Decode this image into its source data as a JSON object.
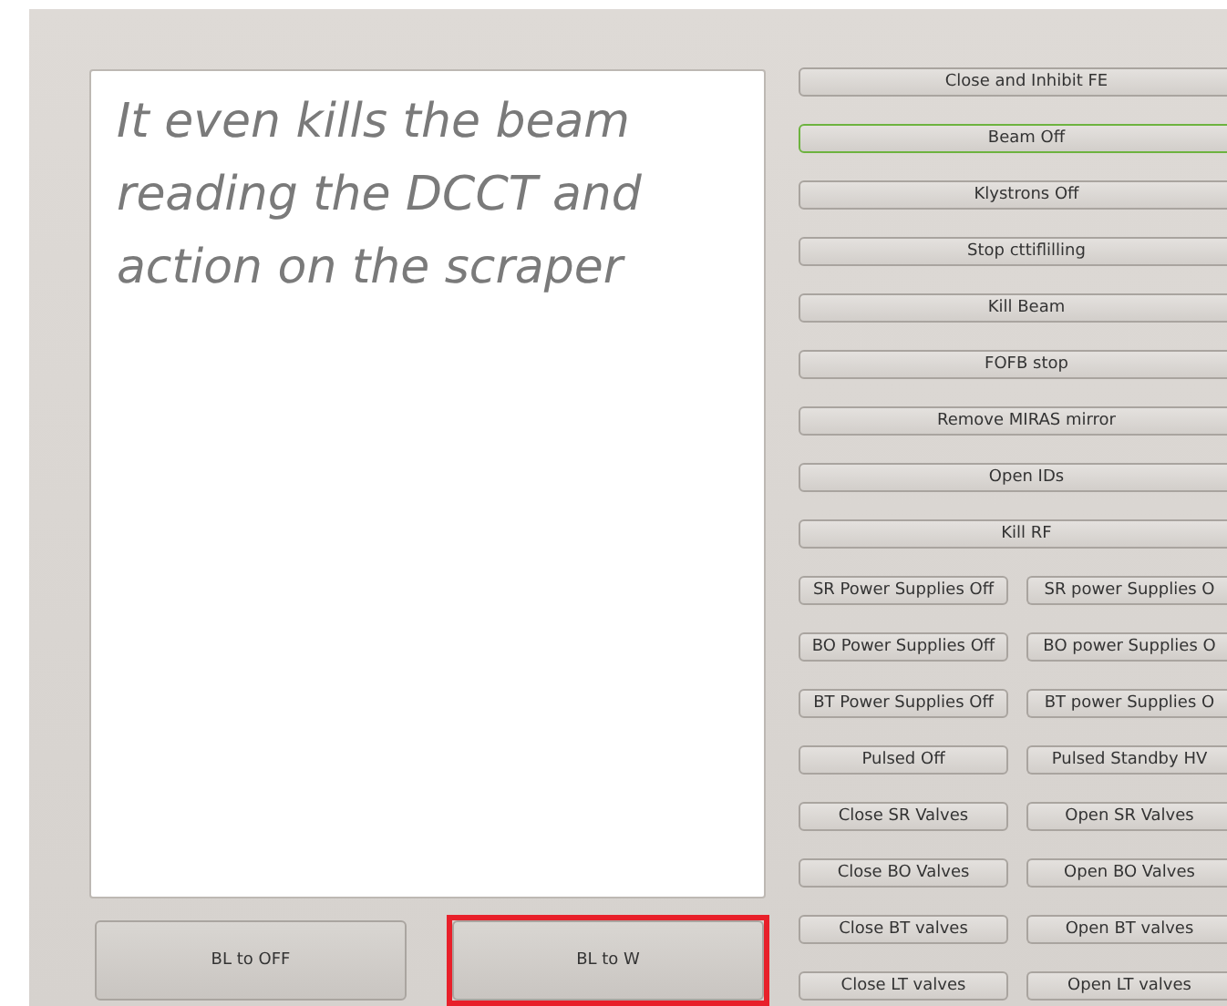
{
  "message": "It even kills the beam reading the DCCT and action on the scraper",
  "actions": [
    {
      "kind": "single",
      "buttons": [
        {
          "label": "Close and Inhibit FE",
          "focused": false
        }
      ]
    },
    {
      "kind": "single",
      "buttons": [
        {
          "label": "Beam Off",
          "focused": true
        }
      ]
    },
    {
      "kind": "single",
      "buttons": [
        {
          "label": "Klystrons Off",
          "focused": false
        }
      ]
    },
    {
      "kind": "single",
      "buttons": [
        {
          "label": "Stop cttiflilling",
          "focused": false
        }
      ]
    },
    {
      "kind": "single",
      "buttons": [
        {
          "label": "Kill Beam",
          "focused": false
        }
      ]
    },
    {
      "kind": "single",
      "buttons": [
        {
          "label": "FOFB stop",
          "focused": false
        }
      ]
    },
    {
      "kind": "single",
      "buttons": [
        {
          "label": "Remove MIRAS mirror",
          "focused": false
        }
      ]
    },
    {
      "kind": "single",
      "buttons": [
        {
          "label": "Open IDs",
          "focused": false
        }
      ]
    },
    {
      "kind": "single",
      "buttons": [
        {
          "label": "Kill RF",
          "focused": false
        }
      ]
    },
    {
      "kind": "pair",
      "buttons": [
        {
          "label": "SR Power Supplies Off",
          "focused": false
        },
        {
          "label": "SR power Supplies O",
          "focused": false
        }
      ]
    },
    {
      "kind": "pair",
      "buttons": [
        {
          "label": "BO Power Supplies Off",
          "focused": false
        },
        {
          "label": "BO power Supplies O",
          "focused": false
        }
      ]
    },
    {
      "kind": "pair",
      "buttons": [
        {
          "label": "BT Power Supplies Off",
          "focused": false
        },
        {
          "label": "BT power Supplies O",
          "focused": false
        }
      ]
    },
    {
      "kind": "pair",
      "buttons": [
        {
          "label": "Pulsed Off",
          "focused": false
        },
        {
          "label": "Pulsed Standby HV",
          "focused": false
        }
      ]
    },
    {
      "kind": "pair",
      "buttons": [
        {
          "label": "Close SR Valves",
          "focused": false
        },
        {
          "label": "Open SR Valves",
          "focused": false
        }
      ]
    },
    {
      "kind": "pair",
      "buttons": [
        {
          "label": "Close BO Valves",
          "focused": false
        },
        {
          "label": "Open BO Valves",
          "focused": false
        }
      ]
    },
    {
      "kind": "pair",
      "buttons": [
        {
          "label": "Close BT valves",
          "focused": false
        },
        {
          "label": "Open BT valves",
          "focused": false
        }
      ]
    },
    {
      "kind": "pair",
      "buttons": [
        {
          "label": "Close LT valves",
          "focused": false
        },
        {
          "label": "Open LT valves",
          "focused": false
        }
      ]
    }
  ],
  "bottom_buttons": [
    {
      "label": "BL to OFF",
      "highlighted": false
    },
    {
      "label": "BL to W",
      "highlighted": true
    }
  ]
}
